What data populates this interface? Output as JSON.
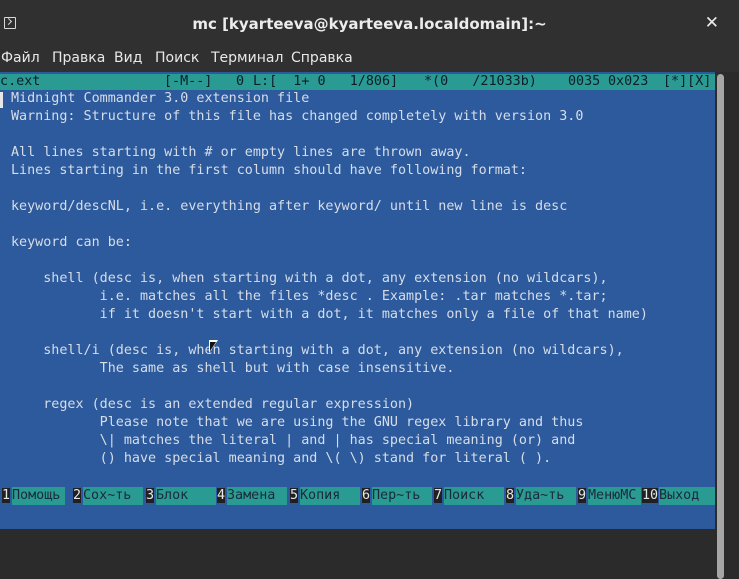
{
  "window": {
    "title": "mc [kyarteeva@kyarteeva.localdomain]:~",
    "close_symbol": "✕"
  },
  "menu": [
    "Файл",
    "Правка",
    "Вид",
    "Поиск",
    "Терминал",
    "Справка"
  ],
  "status": {
    "filename": "mc.ext",
    "mode": "[-M--]",
    "col": "0",
    "line_info": "L:[  1+ 0   1/806]",
    "char_info": "*(0   /21033b)",
    "char_code": "0035",
    "char_hex": "0x023",
    "flags": "[*][X]"
  },
  "file_lines": [
    "Midnight Commander 3.0 extension file",
    "Warning: Structure of this file has changed completely with version 3.0",
    "",
    "All lines starting with # or empty lines are thrown away.",
    "Lines starting in the first column should have following format:",
    "",
    "keyword/descNL, i.e. everything after keyword/ until new line is desc",
    "",
    "keyword can be:",
    "",
    "    shell (desc is, when starting with a dot, any extension (no wildcars),",
    "           i.e. matches all the files *desc . Example: .tar matches *.tar;",
    "           if it doesn't start with a dot, it matches only a file of that name)",
    "",
    "    shell/i (desc is, when starting with a dot, any extension (no wildcars),",
    "           The same as shell but with case insensitive.",
    "",
    "    regex (desc is an extended regular expression)",
    "           Please note that we are using the GNU regex library and thus",
    "           \\| matches the literal | and | has special meaning (or) and",
    "           () have special meaning and \\( \\) stand for literal ( )."
  ],
  "fkeys": [
    {
      "num": "1",
      "label": "Помощь"
    },
    {
      "num": "2",
      "label": "Сох~ть"
    },
    {
      "num": "3",
      "label": "Блок"
    },
    {
      "num": "4",
      "label": "Замена"
    },
    {
      "num": "5",
      "label": "Копия"
    },
    {
      "num": "6",
      "label": "Пер~ть"
    },
    {
      "num": "7",
      "label": "Поиск"
    },
    {
      "num": "8",
      "label": "Уда~ть"
    },
    {
      "num": "9",
      "label": "МенюMC"
    },
    {
      "num": "10",
      "label": "Выход"
    }
  ],
  "colors": {
    "editor_background": "#2c5a9c",
    "status_bar": "#2a9b93",
    "window_chrome": "#303030"
  }
}
